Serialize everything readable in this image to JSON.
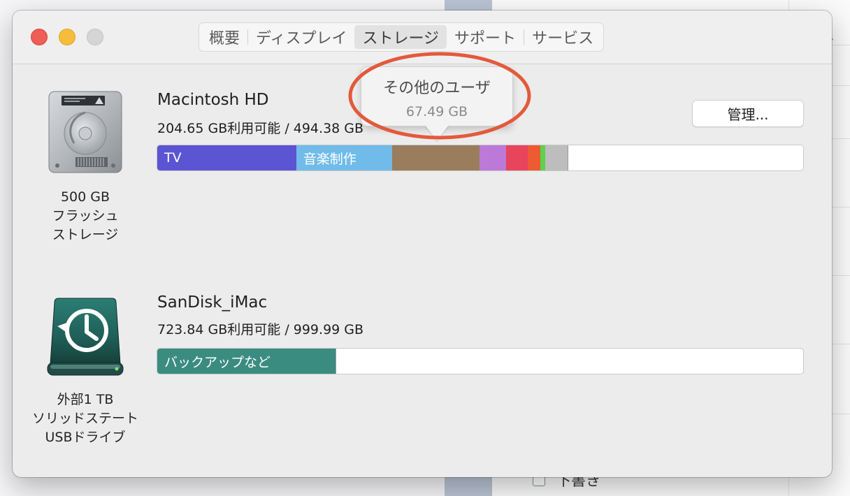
{
  "background_app": {
    "draft_label": "下書き"
  },
  "window": {
    "tabs": [
      {
        "label": "概要",
        "selected": false
      },
      {
        "label": "ディスプレイ",
        "selected": false
      },
      {
        "label": "ストレージ",
        "selected": true
      },
      {
        "label": "サポート",
        "selected": false
      },
      {
        "label": "サービス",
        "selected": false
      }
    ]
  },
  "drives": [
    {
      "name": "Macintosh HD",
      "capacity": "204.65 GB利用可能 / 494.38 GB",
      "caption_lines": [
        "500 GB",
        "フラッシュ",
        "ストレージ"
      ],
      "segments": [
        {
          "label": "TV",
          "share": 0.2151,
          "color": "#5b54d3"
        },
        {
          "label": "音楽制作",
          "share": 0.149,
          "color": "#70bbe9"
        },
        {
          "label": "",
          "share": 0.135,
          "color": "#9a7d5c"
        },
        {
          "label": "",
          "share": 0.041,
          "color": "#bc79d8"
        },
        {
          "label": "",
          "share": 0.0335,
          "color": "#e8445c"
        },
        {
          "label": "",
          "share": 0.0195,
          "color": "#ee5a34"
        },
        {
          "label": "",
          "share": 0.0075,
          "color": "#5fd14d"
        },
        {
          "label": "",
          "share": 0.035,
          "color": "#bdbdbd"
        }
      ],
      "manage_button": "管理..."
    },
    {
      "name": "SanDisk_iMac",
      "capacity": "723.84 GB利用可能 / 999.99 GB",
      "caption_lines": [
        "外部1 TB",
        "ソリッドステート",
        "USBドライブ"
      ],
      "segments": [
        {
          "label": "バックアップなど",
          "share": 0.2755,
          "color": "#3b8c80"
        }
      ]
    }
  ],
  "tooltip": {
    "title": "その他のユーザ",
    "value": "67.49 GB"
  },
  "colors": {
    "annotation_ring": "#e25a3c"
  },
  "icons": {
    "internal_drive": "hard-drive-icon",
    "external_drive": "time-machine-drive-icon"
  }
}
